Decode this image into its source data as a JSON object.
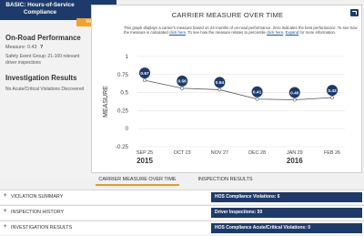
{
  "sidebar": {
    "basic_title": "BASIC: Hours-of-Service Compliance",
    "more_info": "More Info",
    "onroad_title": "On-Road Performance",
    "measure_text": "Measure: 0.43",
    "help_glyph": "?",
    "safety_line1": "Safety Event Group: 21-100 relevant",
    "safety_line2": "driver inspections",
    "investigation_title": "Investigation Results",
    "investigation_text": "No Acute/Critical Violations Discovered"
  },
  "chart_panel": {
    "desc_part1": "This graph displays a carrier's measure based on 24-months of on-road performance. Zero indicates the best performance. To see how the measure is calculated ",
    "link1": "click here",
    "desc_part2": ". To see how the measure relates to percentile ",
    "link2": "click here",
    "desc_part3": ". ",
    "link3": "Expand",
    "desc_part4": " for more information."
  },
  "chart_data": {
    "type": "line",
    "title": "CARRIER MEASURE OVER TIME",
    "ylabel": "MEASURE",
    "ylim": [
      -0.25,
      1.0
    ],
    "yticks": [
      1,
      0.75,
      0.5,
      0.25,
      0,
      -0.25
    ],
    "x": [
      "SEP 25",
      "OCT 23",
      "NOV 27",
      "DEC 28",
      "JAN 29",
      "FEB 26"
    ],
    "year_labels": [
      {
        "label": "2015",
        "at": 0
      },
      {
        "label": "2016",
        "at": 4
      }
    ],
    "series": [
      {
        "values": [
          0.67,
          0.56,
          0.54,
          0.41,
          0.4,
          0.43
        ],
        "labels": [
          "0.67",
          "0.56",
          "0.54",
          "0.41",
          "0.40",
          "0.43"
        ],
        "color": "#1d3a6b"
      }
    ],
    "grid": true
  },
  "tabs": {
    "measure": "CARRIER MEASURE OVER TIME",
    "inspection": "INSPECTION RESULTS"
  },
  "accordion": [
    {
      "plus": "+",
      "label": "VIOLATION SUMMARY",
      "badge": "HOS Compliance Violations: 6"
    },
    {
      "plus": "+",
      "label": "INSPECTION HISTORY",
      "badge": "Driver Inspections: 50"
    },
    {
      "plus": "+",
      "label": "INVESTIGATION RESULTS",
      "badge": "HOS Compliance Acute/Critical Violations: 0"
    }
  ],
  "colors": {
    "navy": "#1d3a6b",
    "accent": "#f2a12a",
    "link": "#1a55a5",
    "tab_underline": "#e09b2c"
  }
}
